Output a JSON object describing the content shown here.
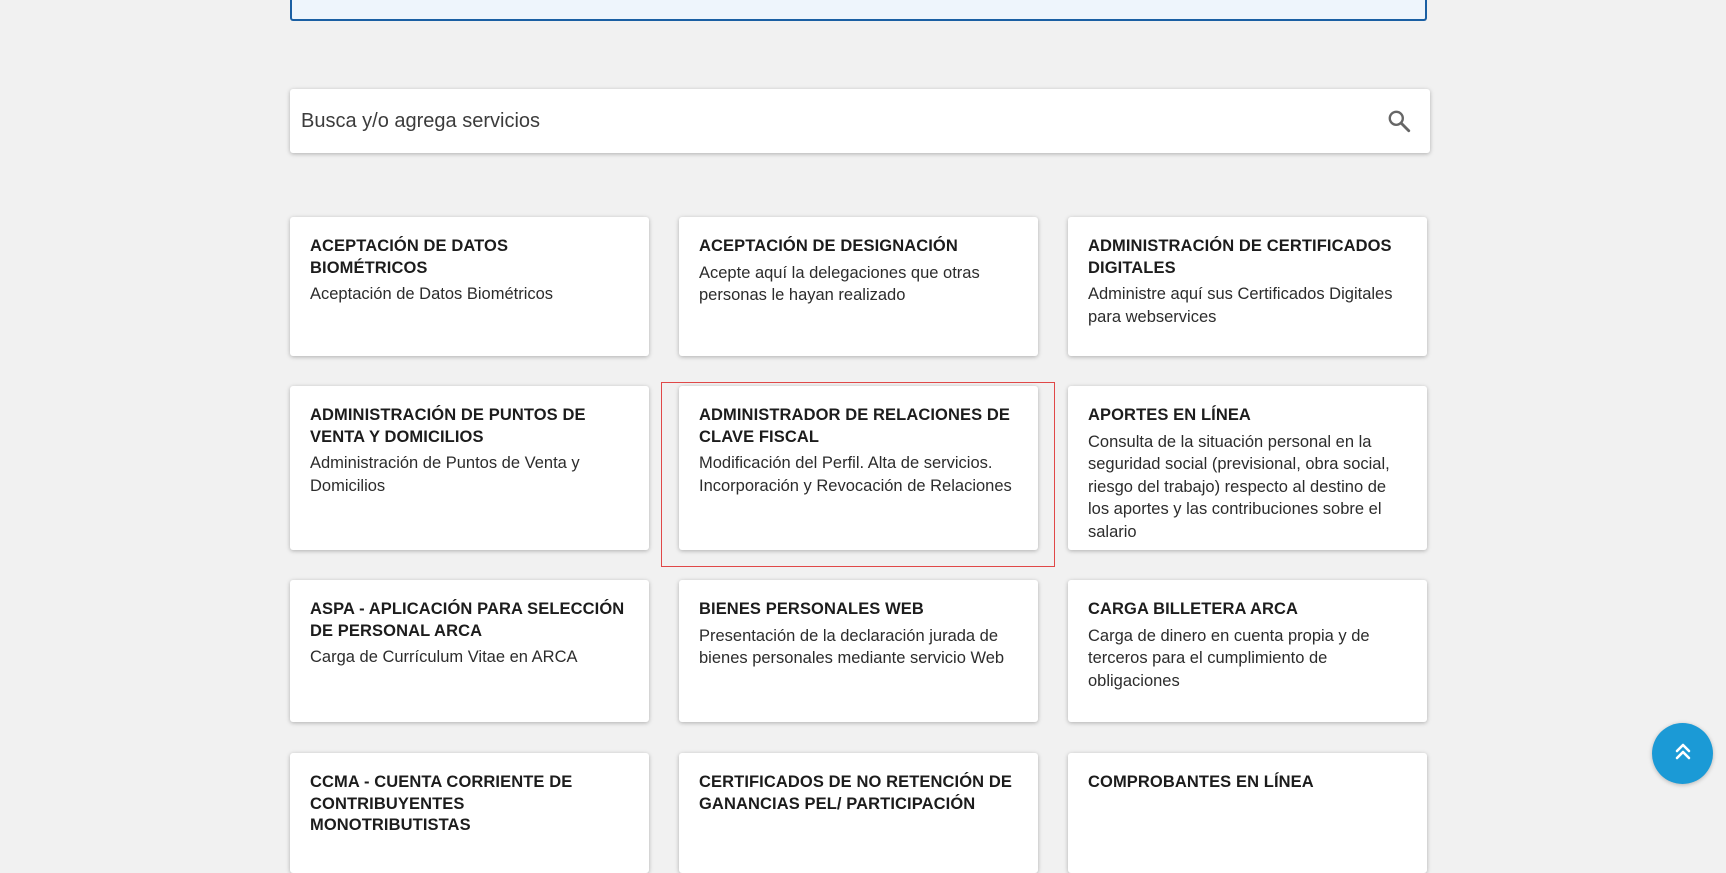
{
  "search": {
    "placeholder": "Busca y/o agrega servicios",
    "icon": "search-icon"
  },
  "services": [
    {
      "title": "ACEPTACIÓN DE DATOS BIOMÉTRICOS",
      "description": "Aceptación de Datos Biométricos"
    },
    {
      "title": "ACEPTACIÓN DE DESIGNACIÓN",
      "description": "Acepte aquí la delegaciones que otras personas le hayan realizado"
    },
    {
      "title": "ADMINISTRACIÓN DE CERTIFICADOS DIGITALES",
      "description": "Administre aquí sus Certificados Digitales para webservices"
    },
    {
      "title": "ADMINISTRACIÓN DE PUNTOS DE VENTA Y DOMICILIOS",
      "description": "Administración de Puntos de Venta y Domicilios"
    },
    {
      "title": "ADMINISTRADOR DE RELACIONES DE CLAVE FISCAL",
      "description": "Modificación del Perfil. Alta de servicios. Incorporación y Revocación de Relaciones"
    },
    {
      "title": "APORTES EN LÍNEA",
      "description": "Consulta de la situación personal en la seguridad social (previsional, obra social, riesgo del trabajo) respecto al destino de los aportes y las contribuciones sobre el salario"
    },
    {
      "title": "ASPA - APLICACIÓN PARA SELECCIÓN DE PERSONAL ARCA",
      "description": "Carga de Currículum Vitae en ARCA"
    },
    {
      "title": "BIENES PERSONALES WEB",
      "description": "Presentación de la declaración jurada de bienes personales mediante servicio Web"
    },
    {
      "title": "CARGA BILLETERA ARCA",
      "description": "Carga de dinero en cuenta propia y de terceros para el cumplimiento de obligaciones"
    },
    {
      "title": "CCMA - CUENTA CORRIENTE DE CONTRIBUYENTES MONOTRIBUTISTAS",
      "description": ""
    },
    {
      "title": "CERTIFICADOS DE NO RETENCIÓN DE GANANCIAS PEL/ PARTICIPACIÓN",
      "description": ""
    },
    {
      "title": "COMPROBANTES EN LÍNEA",
      "description": ""
    }
  ],
  "scroll_top": {
    "icon": "double-chevron-up-icon"
  },
  "colors": {
    "background": "#f1f1f1",
    "accent": "#1b9ad6",
    "banner_border": "#1a5fa3",
    "highlight": "#e04848"
  }
}
